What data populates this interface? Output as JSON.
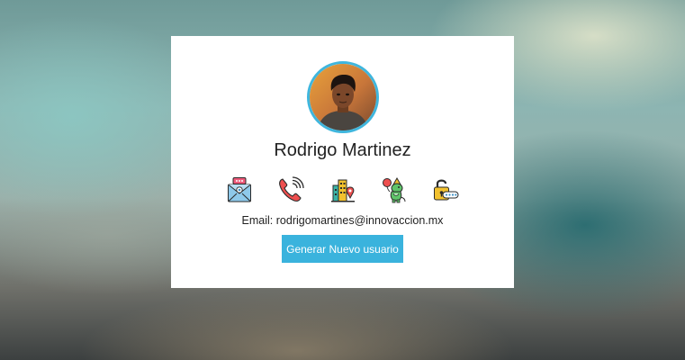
{
  "profile": {
    "name": "Rodrigo Martinez",
    "email_label": "Email: rodrigomartines@innovaccion.mx"
  },
  "actions": {
    "generate_label": "Generar Nuevo usuario"
  },
  "icons": [
    "email-icon",
    "phone-icon",
    "location-icon",
    "birthday-icon",
    "password-icon"
  ],
  "colors": {
    "accent": "#3ab3dd",
    "avatar_border": "#3fb6dd"
  }
}
